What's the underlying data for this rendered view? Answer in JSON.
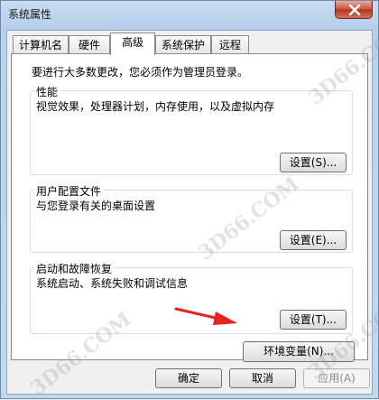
{
  "window": {
    "title": "系统属性"
  },
  "tabs": [
    {
      "label": "计算机名",
      "active": false
    },
    {
      "label": "硬件",
      "active": false
    },
    {
      "label": "高级",
      "active": true
    },
    {
      "label": "系统保护",
      "active": false
    },
    {
      "label": "远程",
      "active": false
    }
  ],
  "notice": "要进行大多数更改，您必须作为管理员登录。",
  "groups": {
    "performance": {
      "title": "性能",
      "description": "视觉效果，处理器计划，内存使用，以及虚拟内存",
      "button": "设置(S)..."
    },
    "profiles": {
      "title": "用户配置文件",
      "description": "与您登录有关的桌面设置",
      "button": "设置(E)..."
    },
    "startup": {
      "title": "启动和故障恢复",
      "description": "系统启动、系统失败和调试信息",
      "button": "设置(T)..."
    }
  },
  "env_button": "环境变量(N)...",
  "footer": {
    "ok": "确定",
    "cancel": "取消",
    "apply": "应用(A)"
  },
  "watermark": "3D66.COM",
  "colors": {
    "arrow": "#e8231a",
    "close_button": "#c9503b"
  },
  "icons": {
    "close": "close-icon",
    "annotation": "red-arrow-icon"
  }
}
